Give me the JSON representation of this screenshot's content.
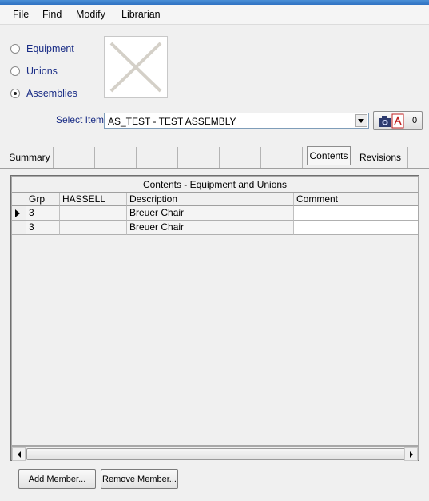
{
  "menu": {
    "file": "File",
    "find": "Find",
    "modify": "Modify",
    "librarian": "Librarian"
  },
  "radios": {
    "equipment": "Equipment",
    "unions": "Unions",
    "assemblies": "Assemblies",
    "selected": "Assemblies"
  },
  "select_item": {
    "label": "Select Item",
    "value": "AS_TEST - TEST ASSEMBLY"
  },
  "attachments": {
    "count": "0",
    "icons": [
      "camera-icon",
      "pdf-icon"
    ]
  },
  "tabs": {
    "summary": "Summary",
    "contents": "Contents",
    "revisions": "Revisions",
    "active": "Contents"
  },
  "grid": {
    "caption": "Contents - Equipment and Unions",
    "columns": {
      "grp": "Grp",
      "hassell": "HASSELL",
      "description": "Description",
      "comment": "Comment"
    },
    "rows": [
      {
        "grp": "3",
        "hassell": "",
        "description": "Breuer Chair",
        "comment": ""
      },
      {
        "grp": "3",
        "hassell": "",
        "description": "Breuer Chair",
        "comment": ""
      }
    ]
  },
  "buttons": {
    "add_member": "Add Member...",
    "remove_member": "Remove Member..."
  },
  "colors": {
    "label_blue": "#1a2d86",
    "title_blue": "#2f72c2",
    "grid_background": "#a8a8a8"
  }
}
